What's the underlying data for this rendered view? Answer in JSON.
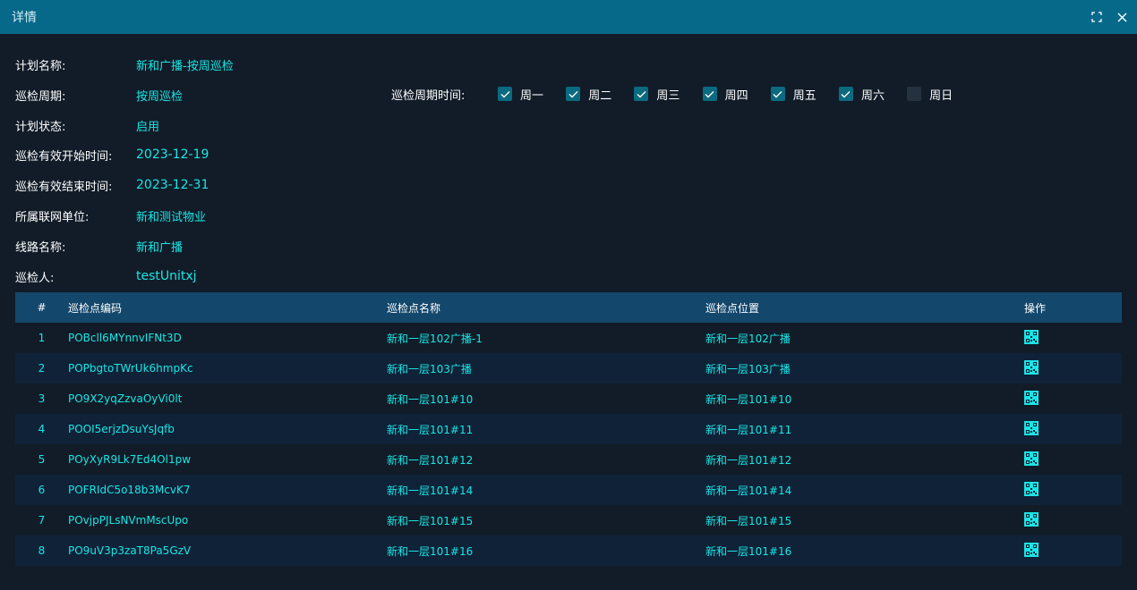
{
  "window": {
    "title": "详情",
    "icons": [
      "maximize-icon",
      "close-icon"
    ]
  },
  "info": [
    {
      "label": "计划名称:",
      "value": "新和广播-按周巡检"
    },
    {
      "label": "巡检周期:",
      "value": "按周巡检"
    },
    {
      "label": "计划状态:",
      "value": "启用"
    },
    {
      "label": "巡检有效开始时间:",
      "value": "2023-12-19"
    },
    {
      "label": "巡检有效结束时间:",
      "value": "2023-12-31"
    },
    {
      "label": "所属联网单位:",
      "value": "新和测试物业"
    },
    {
      "label": "线路名称:",
      "value": "新和广播"
    },
    {
      "label": "巡检人:",
      "value": "testUnitxj"
    }
  ],
  "weekdays": {
    "label": "巡检周期时间:",
    "days": [
      {
        "label": "周一",
        "checked": true
      },
      {
        "label": "周二",
        "checked": true
      },
      {
        "label": "周三",
        "checked": true
      },
      {
        "label": "周四",
        "checked": true
      },
      {
        "label": "周五",
        "checked": true
      },
      {
        "label": "周六",
        "checked": true
      },
      {
        "label": "周日",
        "checked": false
      }
    ]
  },
  "table": {
    "headers": [
      "#",
      "巡检点编码",
      "巡检点名称",
      "巡检点位置",
      "操作"
    ],
    "rows": [
      {
        "idx": "1",
        "code": "POBcll6MYnnvIFNt3D",
        "name": "新和一层102广播-1",
        "position": "新和一层102广播"
      },
      {
        "idx": "2",
        "code": "POPbgtoTWrUk6hmpKc",
        "name": "新和一层103广播",
        "position": "新和一层103广播"
      },
      {
        "idx": "3",
        "code": "PO9X2yqZzvaOyVi0lt",
        "name": "新和一层101#10",
        "position": "新和一层101#10"
      },
      {
        "idx": "4",
        "code": "POOI5erjzDsuYsJqfb",
        "name": "新和一层101#11",
        "position": "新和一层101#11"
      },
      {
        "idx": "5",
        "code": "POyXyR9Lk7Ed4Ol1pw",
        "name": "新和一层101#12",
        "position": "新和一层101#12"
      },
      {
        "idx": "6",
        "code": "POFRIdC5o18b3McvK7",
        "name": "新和一层101#14",
        "position": "新和一层101#14"
      },
      {
        "idx": "7",
        "code": "POvjpPJLsNVmMscUpo",
        "name": "新和一层101#15",
        "position": "新和一层101#15"
      },
      {
        "idx": "8",
        "code": "PO9uV3p3zaT8Pa5GzV",
        "name": "新和一层101#16",
        "position": "新和一层101#16"
      }
    ],
    "row_action_icon": "qrcode-icon"
  },
  "colors": {
    "titlebar": "#06698a",
    "background": "#111c28",
    "header_row": "#14476c",
    "accent_text": "#19e6e6",
    "checkbox_on": "#0a6a80"
  }
}
